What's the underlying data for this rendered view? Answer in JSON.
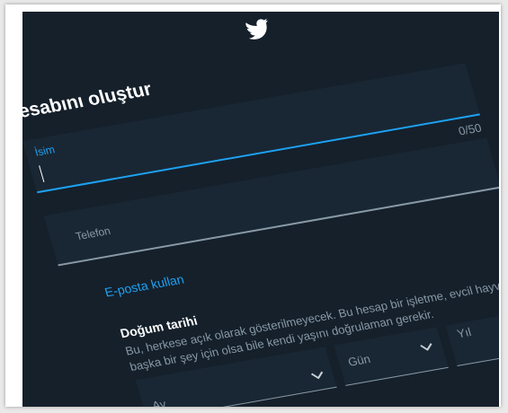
{
  "header": {
    "logo_icon": "twitter-bird-icon"
  },
  "form": {
    "title": "Hesabını oluştur",
    "name_field": {
      "label": "İsim",
      "counter": "0/50"
    },
    "phone_field": {
      "label": "Telefon"
    },
    "email_link": "E-posta kullan",
    "dob": {
      "title": "Doğum tarihi",
      "description_line1": "Bu, herkese açık olarak gösterilmeyecek. Bu hesap bir işletme, evcil hayvan veya",
      "description_line2": "başka bir şey için olsa bile kendi yaşını doğrulaman gerekir.",
      "month_label": "Ay",
      "day_label": "Gün",
      "year_label": "Yıl"
    }
  },
  "colors": {
    "background": "#15202b",
    "field_bg": "#192734",
    "accent": "#1da1f2",
    "muted": "#8899a6"
  }
}
